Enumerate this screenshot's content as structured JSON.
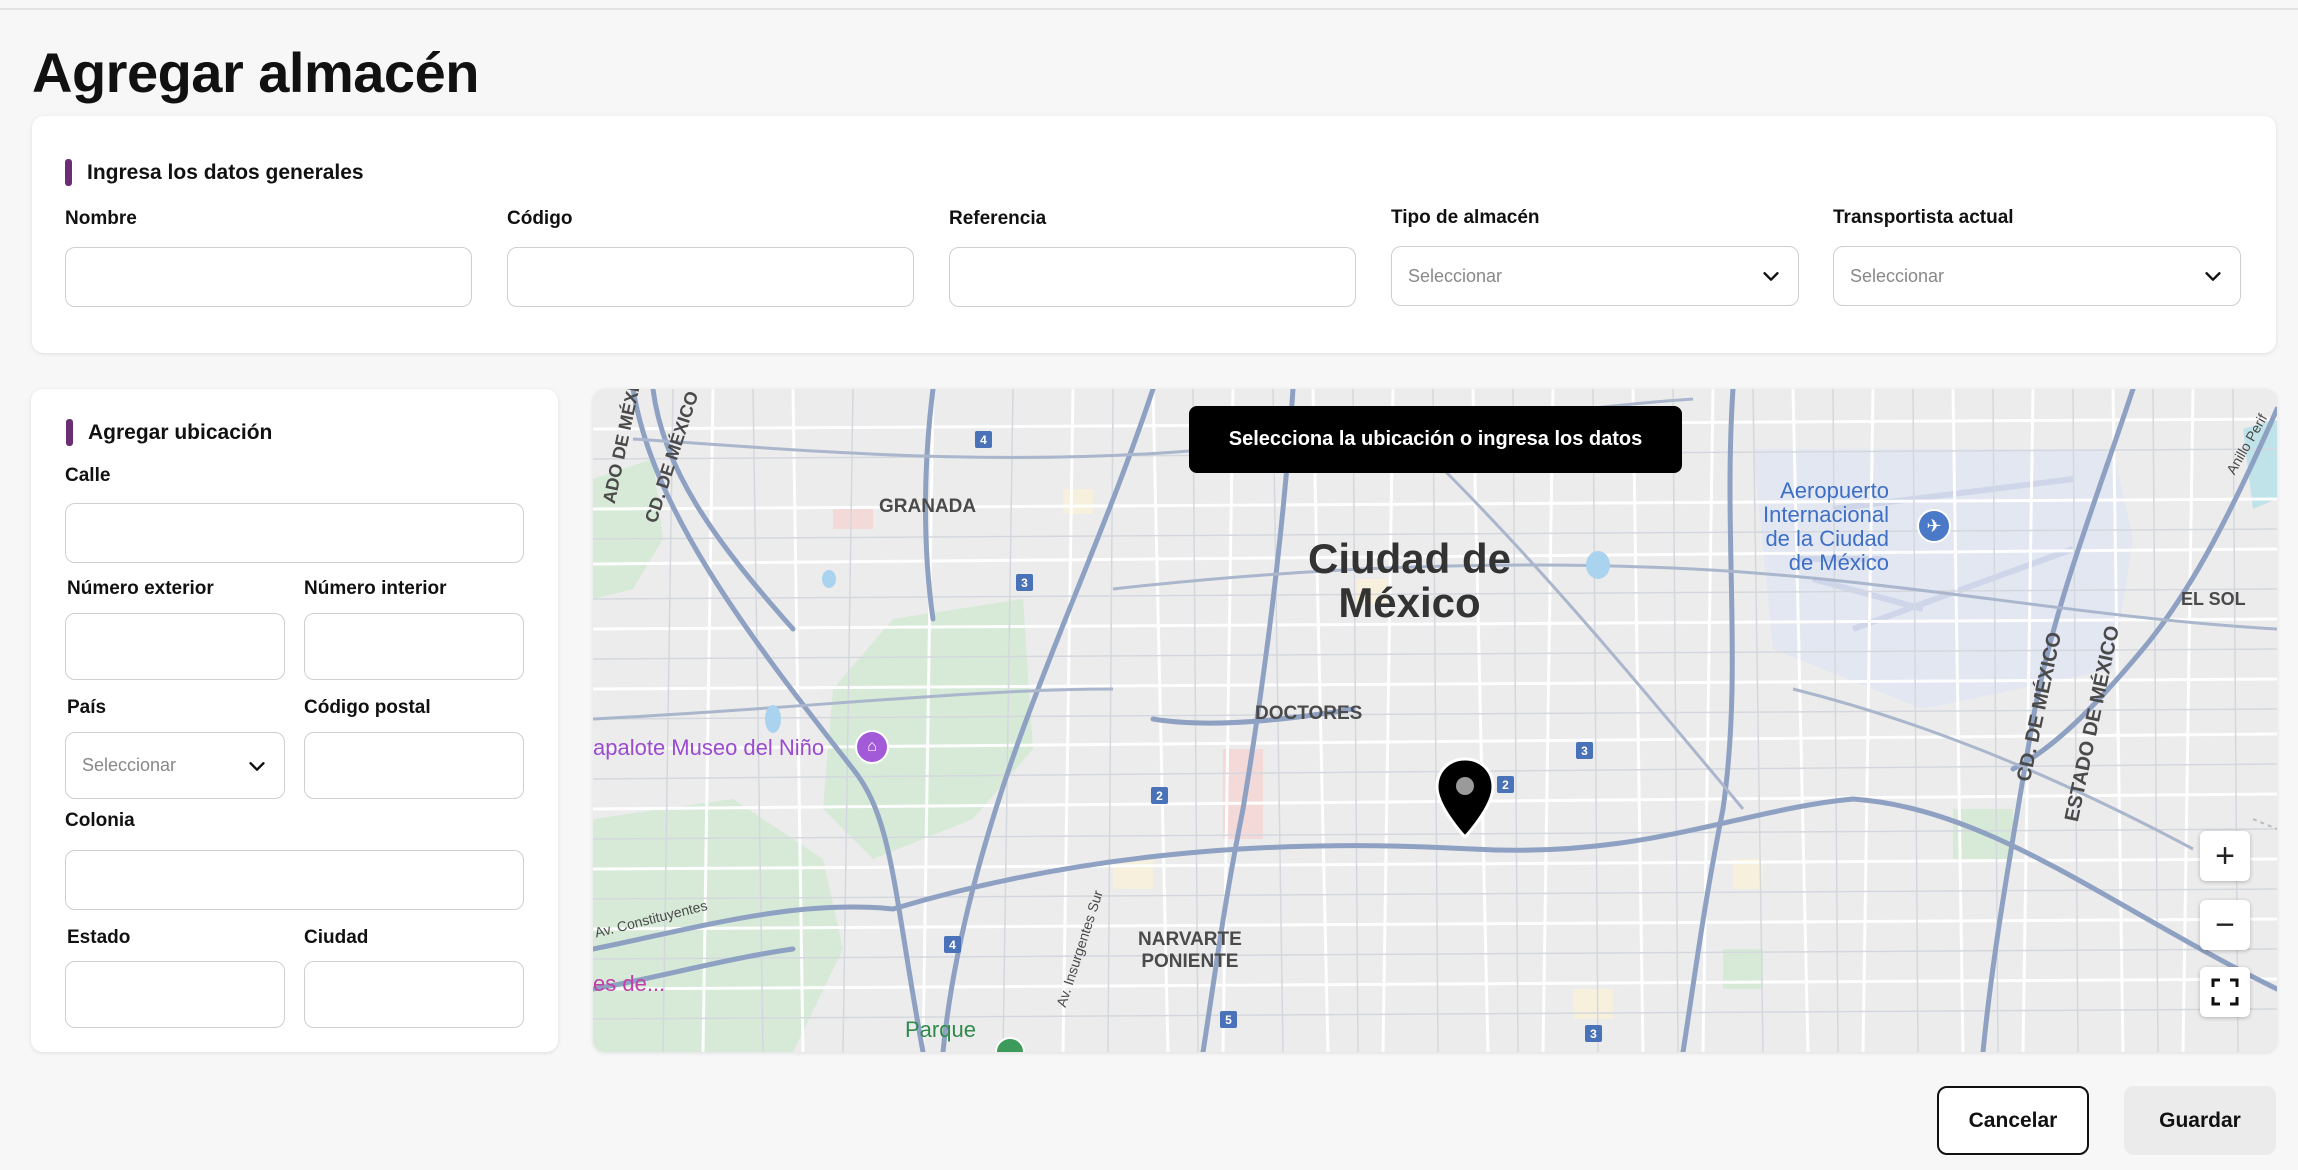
{
  "page": {
    "title": "Agregar almacén"
  },
  "general": {
    "section_title": "Ingresa los datos generales",
    "fields": {
      "nombre": {
        "label": "Nombre",
        "value": ""
      },
      "codigo": {
        "label": "Código",
        "value": ""
      },
      "referencia": {
        "label": "Referencia",
        "value": ""
      },
      "tipo_almacen": {
        "label": "Tipo de almacén",
        "value": "Seleccionar"
      },
      "transportista": {
        "label": "Transportista actual",
        "value": "Seleccionar"
      }
    }
  },
  "location": {
    "section_title": "Agregar ubicación",
    "fields": {
      "calle": {
        "label": "Calle",
        "value": ""
      },
      "num_exterior": {
        "label": "Número exterior",
        "value": ""
      },
      "num_interior": {
        "label": "Número interior",
        "value": ""
      },
      "pais": {
        "label": "País",
        "value": "Seleccionar"
      },
      "codigo_postal": {
        "label": "Código postal",
        "value": ""
      },
      "colonia": {
        "label": "Colonia",
        "value": ""
      },
      "estado": {
        "label": "Estado",
        "value": ""
      },
      "ciudad": {
        "label": "Ciudad",
        "value": ""
      }
    }
  },
  "map": {
    "banner": "Selecciona la ubicación o ingresa los datos",
    "labels": {
      "city_line1": "Ciudad de",
      "city_line2": "México",
      "granada": "GRANADA",
      "doctores": "DOCTORES",
      "narvarte_1": "NARVARTE",
      "narvarte_2": "PONIENTE",
      "el_sol": "EL SOL",
      "airport_1": "Aeropuerto",
      "airport_2": "Internacional",
      "airport_3": "de la Ciudad",
      "airport_4": "de México",
      "museo": "apalote Museo del Niño",
      "parque": "Parque",
      "es_de": "es de...",
      "road_cd_mexico_left": "CD. DE MÉXICO",
      "road_estado_left": "ADO DE MÉXIC",
      "road_cd_mexico_right": "CD. DE MÉXICO",
      "road_estado_right": "ESTADO DE MÉXICO",
      "road_insurgentes": "Av. Insurgentes Sur",
      "road_constituyentes": "Av. Constituyentes",
      "road_anillo": "Anillo Perif"
    },
    "shields": [
      "4",
      "3",
      "2",
      "4",
      "5",
      "3",
      "3",
      "2"
    ],
    "zoom_in": "+",
    "zoom_out": "−"
  },
  "actions": {
    "cancel": "Cancelar",
    "save": "Guardar"
  },
  "colors": {
    "accent": "#6b2d73",
    "banner": "#000000",
    "road": "#8fa1c2"
  }
}
